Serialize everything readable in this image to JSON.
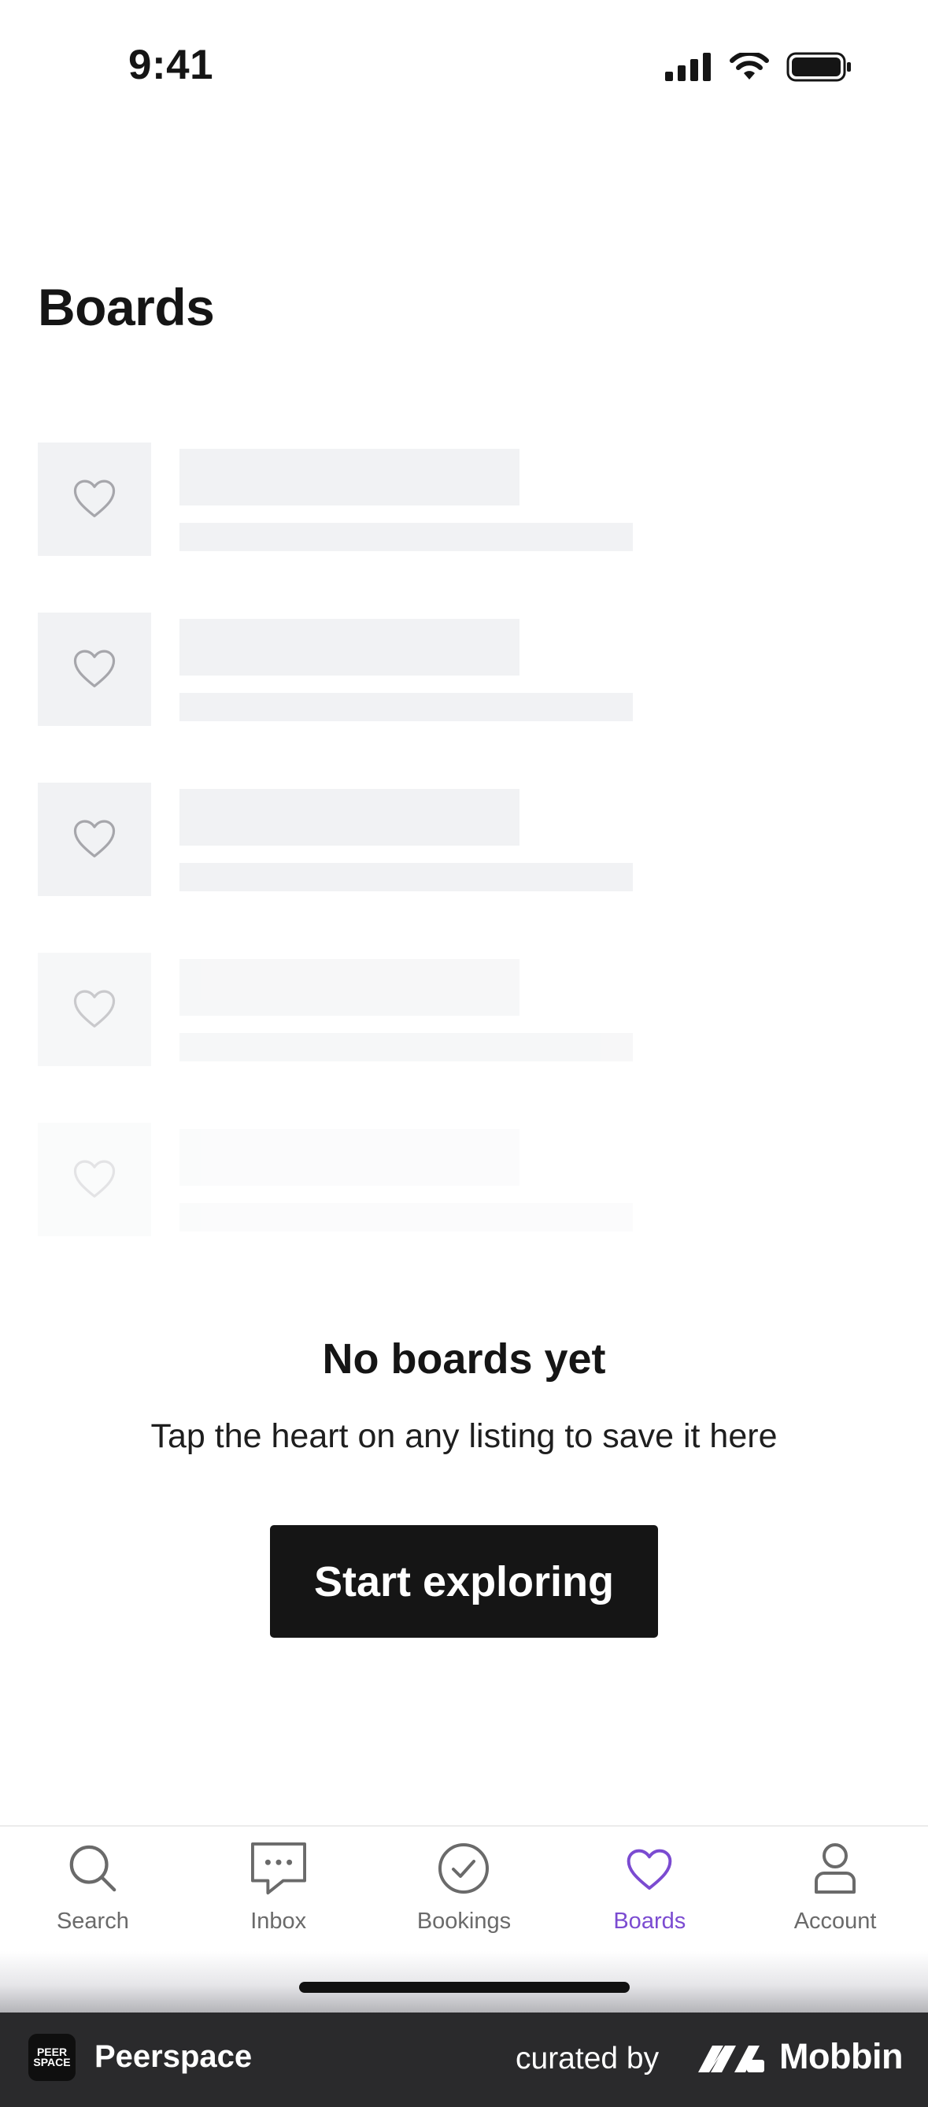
{
  "status_bar": {
    "time": "9:41"
  },
  "page": {
    "title": "Boards"
  },
  "skeleton_rows": [
    {
      "opacity": 1
    },
    {
      "opacity": 1
    },
    {
      "opacity": 1
    },
    {
      "opacity": 0.6
    },
    {
      "opacity": 0.3
    }
  ],
  "empty_state": {
    "title": "No boards yet",
    "subtitle": "Tap the heart on any listing to save it here",
    "button_label": "Start exploring"
  },
  "tab_bar": {
    "active": "Boards",
    "tabs": [
      {
        "label": "Search",
        "icon": "search-icon"
      },
      {
        "label": "Inbox",
        "icon": "chat-bubble-icon"
      },
      {
        "label": "Bookings",
        "icon": "check-circle-icon"
      },
      {
        "label": "Boards",
        "icon": "heart-icon"
      },
      {
        "label": "Account",
        "icon": "person-icon"
      }
    ]
  },
  "footer": {
    "logo_text": "PEER SPACE",
    "app_name": "Peerspace",
    "curated_by": "curated by",
    "brand": "Mobbin"
  },
  "colors": {
    "accent": "#7b4bd1",
    "skeleton": "#f1f2f4",
    "button": "#151515",
    "footer": "#2a2a2c"
  }
}
